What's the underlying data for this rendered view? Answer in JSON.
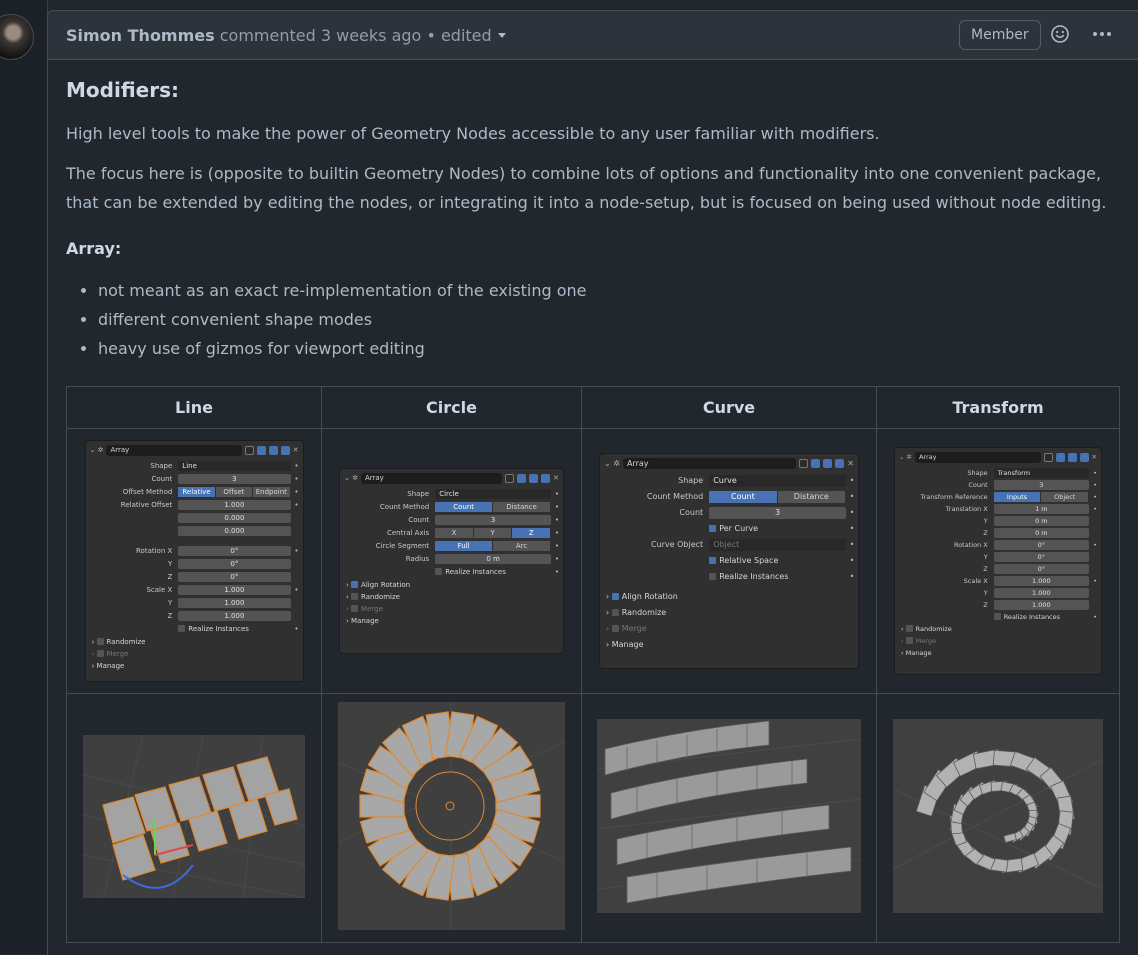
{
  "comment": {
    "author": "Simon Thommes",
    "action": "commented",
    "time": "3 weeks ago",
    "edited": "• edited",
    "role_badge": "Member",
    "emoji_icon": "smiley-icon",
    "more_icon": "kebab-horizontal-icon"
  },
  "content": {
    "heading": "Modifiers:",
    "para1": "High level tools to make the power of Geometry Nodes accessible to any user familiar with modifiers.",
    "para2": "The focus here is (opposite to builtin Geometry Nodes) to combine lots of options and functionality into one convenient package, that can be extended by editing the nodes, or integrating it into a node-setup, but is focused on being used without node editing.",
    "subheading": "Array:",
    "bullets": [
      "not meant as an exact re-implementation of the existing one",
      "different convenient shape modes",
      "heavy use of gizmos for viewport editing"
    ]
  },
  "table": {
    "headers": [
      "Line",
      "Circle",
      "Curve",
      "Transform"
    ],
    "line_panel": {
      "name": "Array",
      "shape_label": "Shape",
      "shape": "Line",
      "count_label": "Count",
      "count": "3",
      "offset_method_label": "Offset Method",
      "offset_methods": [
        "Relative",
        "Offset",
        "Endpoint"
      ],
      "relative_offset_label": "Relative Offset",
      "rel": [
        "1.000",
        "0.000",
        "0.000"
      ],
      "rot_labels": [
        "Rotation X",
        "Y",
        "Z"
      ],
      "rot": [
        "0°",
        "0°",
        "0°"
      ],
      "scale_labels": [
        "Scale X",
        "Y",
        "Z"
      ],
      "scale": [
        "1.000",
        "1.000",
        "1.000"
      ],
      "realize": "Realize Instances",
      "randomize": "Randomize",
      "merge": "Merge",
      "manage": "Manage"
    },
    "circle_panel": {
      "name": "Array",
      "shape_label": "Shape",
      "shape": "Circle",
      "count_method_label": "Count Method",
      "count_methods": [
        "Count",
        "Distance"
      ],
      "count_label": "Count",
      "count": "3",
      "axis_label": "Central Axis",
      "axes": [
        "X",
        "Y",
        "Z"
      ],
      "segment_label": "Circle Segment",
      "segments": [
        "Full",
        "Arc"
      ],
      "radius_label": "Radius",
      "radius": "0 m",
      "realize": "Realize Instances",
      "align": "Align Rotation",
      "randomize": "Randomize",
      "merge": "Merge",
      "manage": "Manage"
    },
    "curve_panel": {
      "name": "Array",
      "shape_label": "Shape",
      "shape": "Curve",
      "count_method_label": "Count Method",
      "count_methods": [
        "Count",
        "Distance"
      ],
      "count_label": "Count",
      "count": "3",
      "per_curve": "Per Curve",
      "curve_object_label": "Curve Object",
      "curve_object": "Object",
      "relative_space": "Relative Space",
      "realize": "Realize Instances",
      "align": "Align Rotation",
      "randomize": "Randomize",
      "merge": "Merge",
      "manage": "Manage"
    },
    "transform_panel": {
      "name": "Array",
      "shape_label": "Shape",
      "shape": "Transform",
      "count_label": "Count",
      "count": "3",
      "ref_label": "Transform Reference",
      "refs": [
        "Inputs",
        "Object"
      ],
      "trans_labels": [
        "Translation X",
        "Y",
        "Z"
      ],
      "trans": [
        "1 m",
        "0 m",
        "0 m"
      ],
      "rot_labels": [
        "Rotation X",
        "Y",
        "Z"
      ],
      "rot": [
        "0°",
        "0°",
        "0°"
      ],
      "scale_labels": [
        "Scale X",
        "Y",
        "Z"
      ],
      "scale": [
        "1.000",
        "1.000",
        "1.000"
      ],
      "realize": "Realize Instances",
      "randomize": "Randomize",
      "merge": "Merge",
      "manage": "Manage"
    }
  }
}
